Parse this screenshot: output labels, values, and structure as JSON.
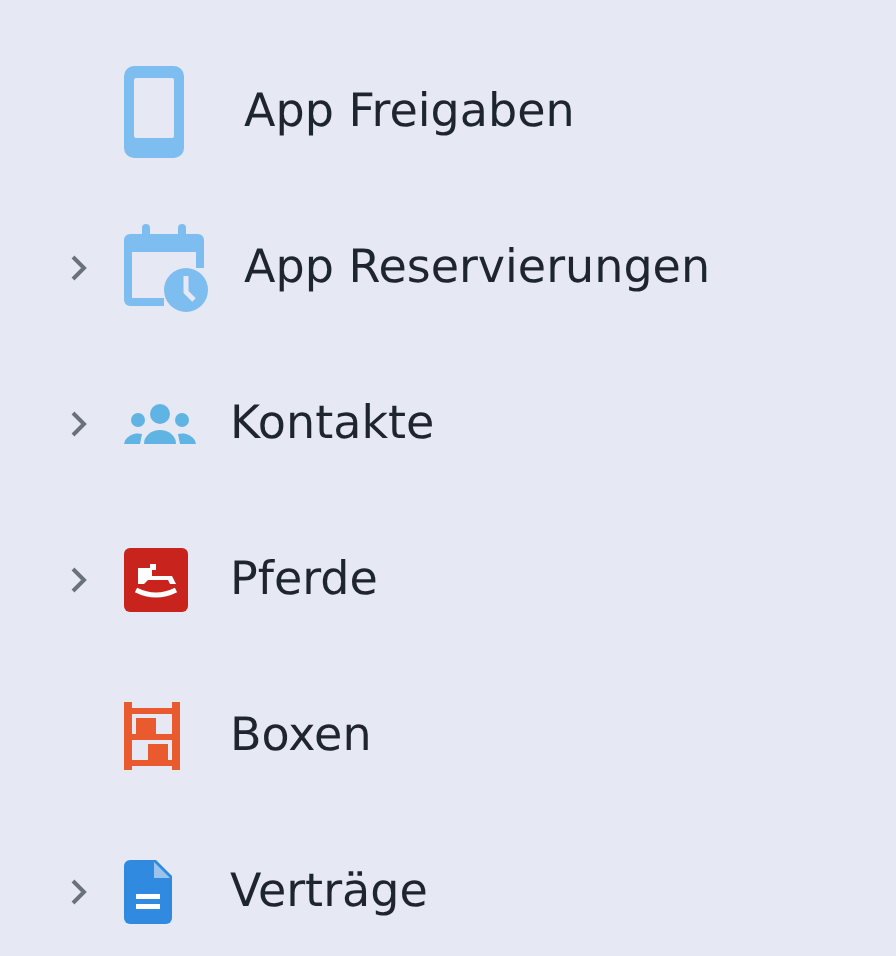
{
  "sidebar": {
    "items": [
      {
        "label": "App Freigaben",
        "kind": "tablet",
        "expandable": false
      },
      {
        "label": "App Reservierungen",
        "kind": "calendar",
        "expandable": true
      },
      {
        "label": "Kontakte",
        "kind": "people",
        "expandable": true
      },
      {
        "label": "Pferde",
        "kind": "horse",
        "expandable": true
      },
      {
        "label": "Boxen",
        "kind": "shelf",
        "expandable": false
      },
      {
        "label": "Verträge",
        "kind": "document",
        "expandable": true
      }
    ]
  }
}
